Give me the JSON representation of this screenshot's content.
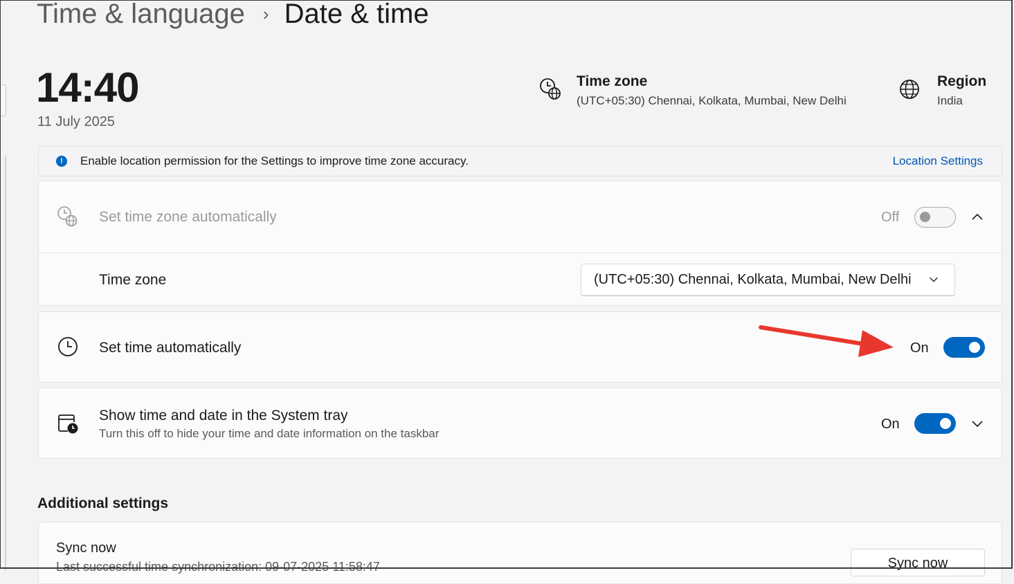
{
  "breadcrumb": {
    "parent": "Time & language",
    "separator": "›",
    "current": "Date & time"
  },
  "clock": {
    "time": "14:40",
    "date": "11 July 2025"
  },
  "time_zone_info": {
    "title": "Time zone",
    "value": "(UTC+05:30) Chennai, Kolkata, Mumbai, New Delhi",
    "icon": "timezone-globe-icon"
  },
  "region_info": {
    "title": "Region",
    "value": "India",
    "icon": "globe-icon"
  },
  "banner": {
    "icon": "info-icon",
    "text": "Enable location permission for the Settings to improve time zone accuracy.",
    "link": "Location Settings"
  },
  "auto_timezone": {
    "label": "Set time zone automatically",
    "state": "Off",
    "enabled": false,
    "expanded": true,
    "icon": "timezone-globe-icon"
  },
  "timezone_select": {
    "label": "Time zone",
    "value": "(UTC+05:30) Chennai, Kolkata, Mumbai, New Delhi"
  },
  "auto_time": {
    "label": "Set time automatically",
    "state": "On",
    "enabled": true,
    "icon": "clock-icon"
  },
  "system_tray": {
    "label": "Show time and date in the System tray",
    "description": "Turn this off to hide your time and date information on the taskbar",
    "state": "On",
    "enabled": true,
    "icon": "calendar-clock-icon"
  },
  "additional": {
    "title": "Additional settings",
    "sync_label": "Sync now",
    "sync_detail": "Last successful time synchronization: 09-07-2025 11:58:47",
    "sync_button": "Sync now"
  },
  "colors": {
    "accent": "#0067c0",
    "link": "#0055b3",
    "annotation_arrow": "#e8372c"
  }
}
